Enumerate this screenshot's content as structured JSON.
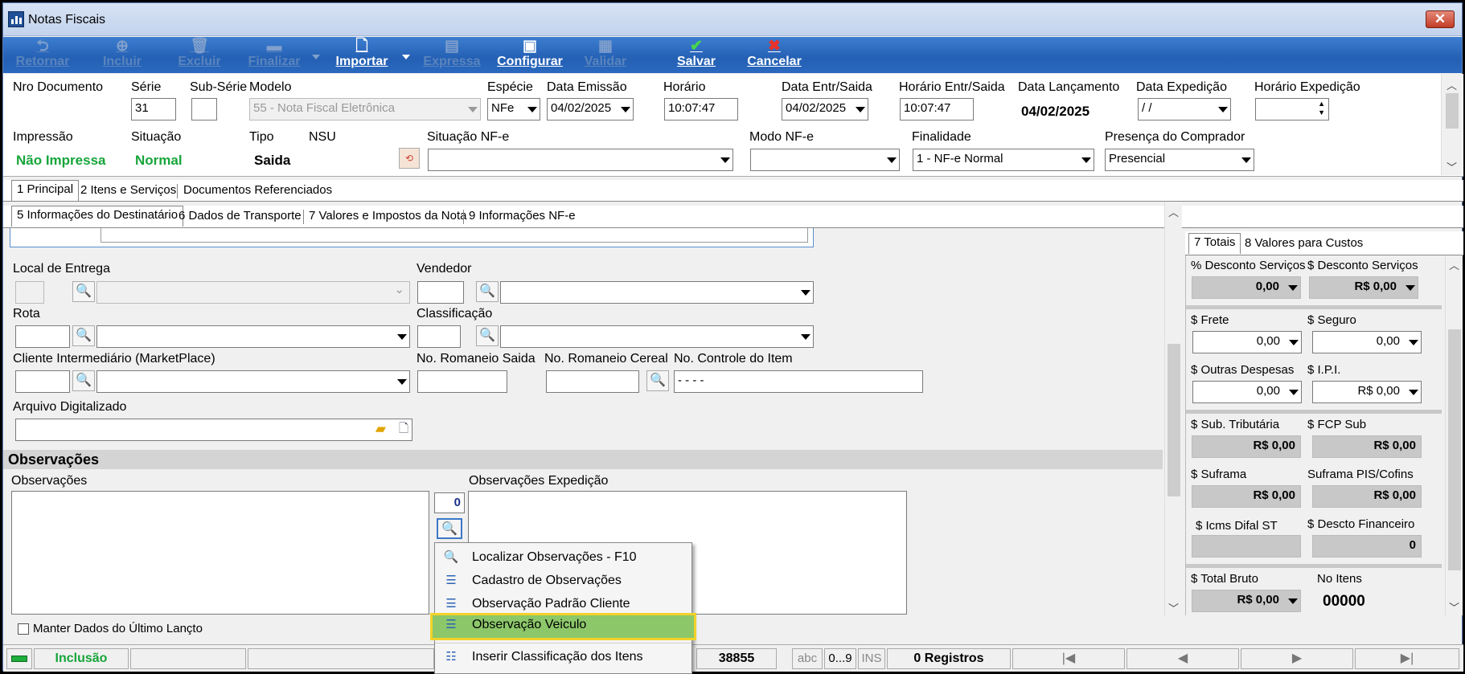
{
  "window": {
    "title": "Notas Fiscais",
    "close": "✕"
  },
  "toolbar": {
    "retornar": "Retornar",
    "incluir": "Incluir",
    "excluir": "Excluir",
    "finalizar": "Finalizar",
    "importar": "Importar",
    "expressa": "Expressa",
    "configurar": "Configurar",
    "validar": "Validar",
    "salvar": "Salvar",
    "cancelar": "Cancelar"
  },
  "header": {
    "nro_documento_label": "Nro Documento",
    "serie_label": "Série",
    "serie_value": "31",
    "subserie_label": "Sub-Série",
    "subserie_value": "",
    "modelo_label": "Modelo",
    "modelo_value": "55 - Nota Fiscal Eletrônica",
    "especie_label": "Espécie",
    "especie_value": "NFe",
    "data_emissao_label": "Data Emissão",
    "data_emissao_value": "04/02/2025",
    "horario_label": "Horário",
    "horario_value": "10:07:47",
    "data_entr_label": "Data Entr/Saida",
    "data_entr_value": "04/02/2025",
    "horario_entr_label": "Horário Entr/Saida",
    "horario_entr_value": "10:07:47",
    "data_lanc_label": "Data Lançamento",
    "data_lanc_value": "04/02/2025",
    "data_exp_label": "Data Expedição",
    "data_exp_value": " /  /",
    "horario_exp_label": "Horário Expedição",
    "horario_exp_value": "",
    "impressao_label": "Impressão",
    "impressao_value": "Não Impressa",
    "situacao_label": "Situação",
    "situacao_value": "Normal",
    "tipo_label": "Tipo",
    "tipo_value": "Saida",
    "nsu_label": "NSU",
    "sit_nfe_label": "Situação NF-e",
    "sit_nfe_value": "",
    "modo_nfe_label": "Modo NF-e",
    "modo_nfe_value": "",
    "finalidade_label": "Finalidade",
    "finalidade_value": "1 - NF-e Normal",
    "presenca_label": "Presença do Comprador",
    "presenca_value": "Presencial"
  },
  "tabs_main": [
    "1 Principal",
    "2 Itens e Serviços",
    "Documentos Referenciados"
  ],
  "tabs_sub": [
    "5 Informações do Destinatário",
    "6 Dados de Transporte",
    "7 Valores e Impostos da Nota",
    "9 Informações NF-e"
  ],
  "form": {
    "local_entrega": "Local de Entrega",
    "vendedor": "Vendedor",
    "rota": "Rota",
    "classificacao": "Classificação",
    "cliente_inter": "Cliente Intermediário (MarketPlace)",
    "romaneio_saida": "No. Romaneio Saida",
    "romaneio_cereal": "No. Romaneio Cereal",
    "controle_item": "No. Controle do Item",
    "controle_item_value": " -  -  -  -",
    "arquivo": "Arquivo Digitalizado",
    "section_obs": "Observações",
    "obs": "Observações",
    "obs_count": "0",
    "obs_exp": "Observações Expedição",
    "manter": "Manter Dados do Último Lançto"
  },
  "right_tabs": [
    "7 Totais",
    "8 Valores para Custos"
  ],
  "totals": {
    "desc_serv_pct_label": "% Desconto Serviços",
    "desc_serv_pct": "0,00",
    "desc_serv_label": "$ Desconto Serviços",
    "desc_serv": "R$ 0,00",
    "frete_label": "$ Frete",
    "frete": "0,00",
    "seguro_label": "$ Seguro",
    "seguro": "0,00",
    "outras_label": "$ Outras Despesas",
    "outras": "0,00",
    "ipi_label": "$ I.P.I.",
    "ipi": "R$ 0,00",
    "subtrib_label": "$ Sub. Tributária",
    "subtrib": "R$ 0,00",
    "fcp_label": "$ FCP Sub",
    "fcp": "R$ 0,00",
    "suframa_label": "$ Suframa",
    "suframa": "R$ 0,00",
    "suframa_pis_label": "Suframa PIS/Cofins",
    "suframa_pis": "R$ 0,00",
    "icms_label": "$ Icms Difal ST",
    "icms": "",
    "desc_fin_label": "$ Descto Financeiro",
    "desc_fin": "0",
    "total_bruto_label": "$ Total Bruto",
    "total_bruto": "R$ 0,00",
    "no_itens_label": "No Itens",
    "no_itens": "00000"
  },
  "context_menu": [
    "Localizar Observações  - F10",
    "Cadastro de Observações",
    "Observação Padrão Cliente",
    "Observação Veiculo",
    "Inserir Classificação dos Itens"
  ],
  "status": {
    "mode": "Inclusão",
    "code": "38855",
    "abc": "abc",
    "digits": "0...9",
    "ins": "INS",
    "registros": "0 Registros",
    "first": "|◀",
    "prev": "◀",
    "next": "▶",
    "last": "▶|"
  },
  "colors": {
    "accent_green": "#17a53a",
    "toolbar_blue": "#2460b4",
    "highlight": "#8cc76a",
    "highlight_border": "#f2d22a"
  }
}
